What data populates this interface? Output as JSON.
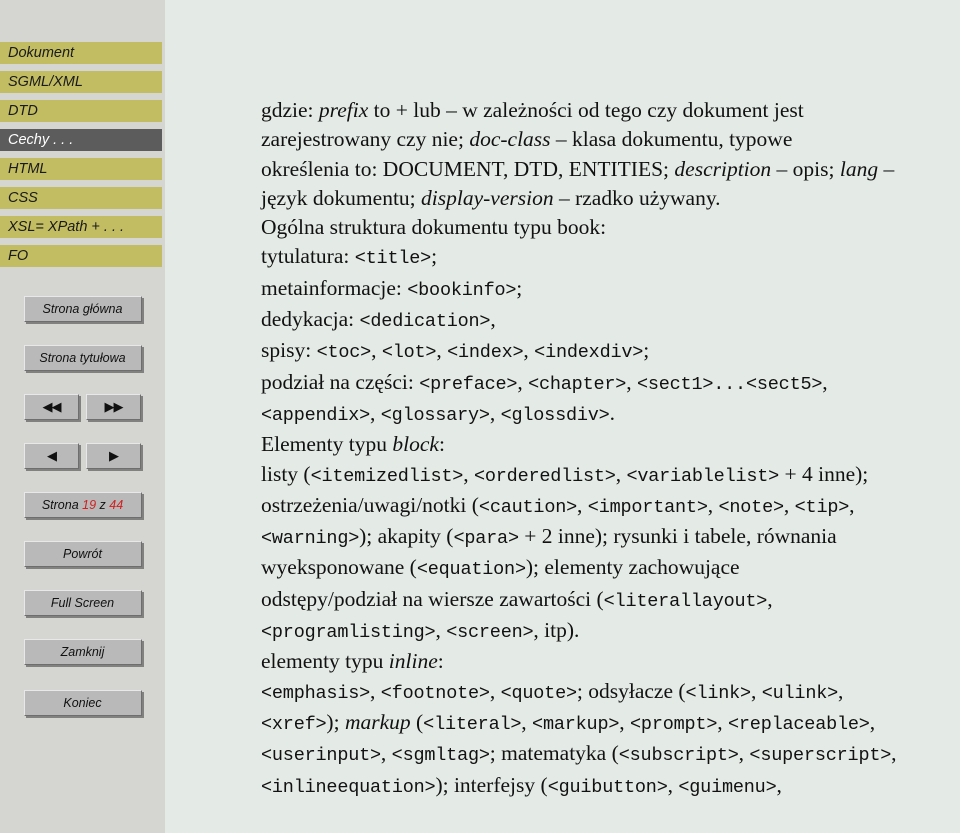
{
  "sidebar": {
    "nav_items": [
      {
        "label": "Dokument",
        "active": false
      },
      {
        "label": "SGML/XML",
        "active": false
      },
      {
        "label": "DTD",
        "active": false
      },
      {
        "label": "Cechy . . .",
        "active": true
      },
      {
        "label": "HTML",
        "active": false
      },
      {
        "label": "CSS",
        "active": false
      },
      {
        "label": "XSL= XPath + . . .",
        "active": false
      },
      {
        "label": "FO",
        "active": false
      }
    ],
    "buttons": {
      "home": "Strona główna",
      "title_page": "Strona tytułowa",
      "first": "◀◀",
      "last": "▶▶",
      "prev": "◀",
      "next": "▶",
      "back": "Powrót",
      "fullscreen": "Full Screen",
      "close": "Zamknij",
      "quit": "Koniec"
    },
    "page_counter": {
      "prefix": "Strona",
      "current": "19",
      "separator": "z",
      "total": "44"
    },
    "colors": {
      "nav_background": "#c2bd62",
      "nav_active_background": "#5c5c5c",
      "sidebar_background": "#d5d6d1",
      "button_face": "#b9b9b9",
      "counter_highlight": "#d02020"
    }
  },
  "content": {
    "background": "#e4eae6",
    "paragraphs": [
      {
        "id": "p1",
        "lines": [
          [
            {
              "t": "gdzie: "
            },
            {
              "t": "prefix",
              "s": "i"
            },
            {
              "t": " to + lub – w zależności od tego czy dokument jest"
            }
          ],
          [
            {
              "t": "zarejestrowany czy nie; "
            },
            {
              "t": "doc-class",
              "s": "i"
            },
            {
              "t": " – klasa dokumentu, typowe"
            }
          ],
          [
            {
              "t": "określenia to: DOCUMENT, DTD, ENTITIES; "
            },
            {
              "t": "description",
              "s": "i"
            },
            {
              "t": " – opis; "
            },
            {
              "t": "lang",
              "s": "i"
            },
            {
              "t": " –"
            }
          ],
          [
            {
              "t": "język dokumentu; "
            },
            {
              "t": "display-version",
              "s": "i"
            },
            {
              "t": " – rzadko używany."
            }
          ]
        ]
      },
      {
        "id": "p2",
        "lines": [
          [
            {
              "t": "Ogólna struktura dokumentu typu book:"
            }
          ],
          [
            {
              "t": "tytulatura: "
            },
            {
              "t": "<title>",
              "s": "tt"
            },
            {
              "t": ";"
            }
          ],
          [
            {
              "t": "metainformacje: "
            },
            {
              "t": "<bookinfo>",
              "s": "tt"
            },
            {
              "t": ";"
            }
          ],
          [
            {
              "t": "dedykacja: "
            },
            {
              "t": "<dedication>",
              "s": "tt"
            },
            {
              "t": ","
            }
          ],
          [
            {
              "t": "spisy: "
            },
            {
              "t": "<toc>",
              "s": "tt"
            },
            {
              "t": ", "
            },
            {
              "t": "<lot>",
              "s": "tt"
            },
            {
              "t": ", "
            },
            {
              "t": "<index>",
              "s": "tt"
            },
            {
              "t": ", "
            },
            {
              "t": "<indexdiv>",
              "s": "tt"
            },
            {
              "t": ";"
            }
          ],
          [
            {
              "t": "podział na części: "
            },
            {
              "t": "<preface>",
              "s": "tt"
            },
            {
              "t": ", "
            },
            {
              "t": "<chapter>",
              "s": "tt"
            },
            {
              "t": ", "
            },
            {
              "t": "<sect1>...<sect5>",
              "s": "tt"
            },
            {
              "t": ","
            }
          ],
          [
            {
              "t": "<appendix>",
              "s": "tt"
            },
            {
              "t": ", "
            },
            {
              "t": "<glossary>",
              "s": "tt"
            },
            {
              "t": ", "
            },
            {
              "t": "<glossdiv>",
              "s": "tt"
            },
            {
              "t": "."
            }
          ],
          [
            {
              "t": "Elementy typu "
            },
            {
              "t": "block",
              "s": "i"
            },
            {
              "t": ":"
            }
          ],
          [
            {
              "t": "listy ("
            },
            {
              "t": "<itemizedlist>",
              "s": "tt"
            },
            {
              "t": ", "
            },
            {
              "t": "<orderedlist>",
              "s": "tt"
            },
            {
              "t": ", "
            },
            {
              "t": "<variablelist>",
              "s": "tt"
            },
            {
              "t": " + 4 inne);"
            }
          ],
          [
            {
              "t": "ostrzeżenia/uwagi/notki ("
            },
            {
              "t": "<caution>",
              "s": "tt"
            },
            {
              "t": ", "
            },
            {
              "t": "<important>",
              "s": "tt"
            },
            {
              "t": ", "
            },
            {
              "t": "<note>",
              "s": "tt"
            },
            {
              "t": ", "
            },
            {
              "t": "<tip>",
              "s": "tt"
            },
            {
              "t": ","
            }
          ],
          [
            {
              "t": "<warning>",
              "s": "tt"
            },
            {
              "t": "); akapity ("
            },
            {
              "t": "<para>",
              "s": "tt"
            },
            {
              "t": " + 2 inne); rysunki i tabele, równania"
            }
          ],
          [
            {
              "t": "wyeksponowane ("
            },
            {
              "t": "<equation>",
              "s": "tt"
            },
            {
              "t": "); elementy zachowujące"
            }
          ],
          [
            {
              "t": "odstępy/podział na wiersze zawartości ("
            },
            {
              "t": "<literallayout>",
              "s": "tt"
            },
            {
              "t": ","
            }
          ],
          [
            {
              "t": "<programlisting>",
              "s": "tt"
            },
            {
              "t": ", "
            },
            {
              "t": "<screen>",
              "s": "tt"
            },
            {
              "t": ", itp)."
            }
          ],
          [
            {
              "t": "elementy typu "
            },
            {
              "t": "inline",
              "s": "i"
            },
            {
              "t": ":"
            }
          ],
          [
            {
              "t": "<emphasis>",
              "s": "tt"
            },
            {
              "t": ", "
            },
            {
              "t": "<footnote>",
              "s": "tt"
            },
            {
              "t": ", "
            },
            {
              "t": "<quote>",
              "s": "tt"
            },
            {
              "t": "; odsyłacze ("
            },
            {
              "t": "<link>",
              "s": "tt"
            },
            {
              "t": ", "
            },
            {
              "t": "<ulink>",
              "s": "tt"
            },
            {
              "t": ","
            }
          ],
          [
            {
              "t": "<xref>",
              "s": "tt"
            },
            {
              "t": "); "
            },
            {
              "t": "markup",
              "s": "i"
            },
            {
              "t": " ("
            },
            {
              "t": "<literal>",
              "s": "tt"
            },
            {
              "t": ", "
            },
            {
              "t": "<markup>",
              "s": "tt"
            },
            {
              "t": ", "
            },
            {
              "t": "<prompt>",
              "s": "tt"
            },
            {
              "t": ", "
            },
            {
              "t": "<replaceable>",
              "s": "tt"
            },
            {
              "t": ","
            }
          ],
          [
            {
              "t": "<userinput>",
              "s": "tt"
            },
            {
              "t": ", "
            },
            {
              "t": "<sgmltag>",
              "s": "tt"
            },
            {
              "t": "; matematyka ("
            },
            {
              "t": "<subscript>",
              "s": "tt"
            },
            {
              "t": ", "
            },
            {
              "t": "<superscript>",
              "s": "tt"
            },
            {
              "t": ","
            }
          ],
          [
            {
              "t": "<inlineequation>",
              "s": "tt"
            },
            {
              "t": "); interfejsy ("
            },
            {
              "t": "<guibutton>",
              "s": "tt"
            },
            {
              "t": ", "
            },
            {
              "t": "<guimenu>",
              "s": "tt"
            },
            {
              "t": ","
            }
          ]
        ]
      }
    ]
  }
}
